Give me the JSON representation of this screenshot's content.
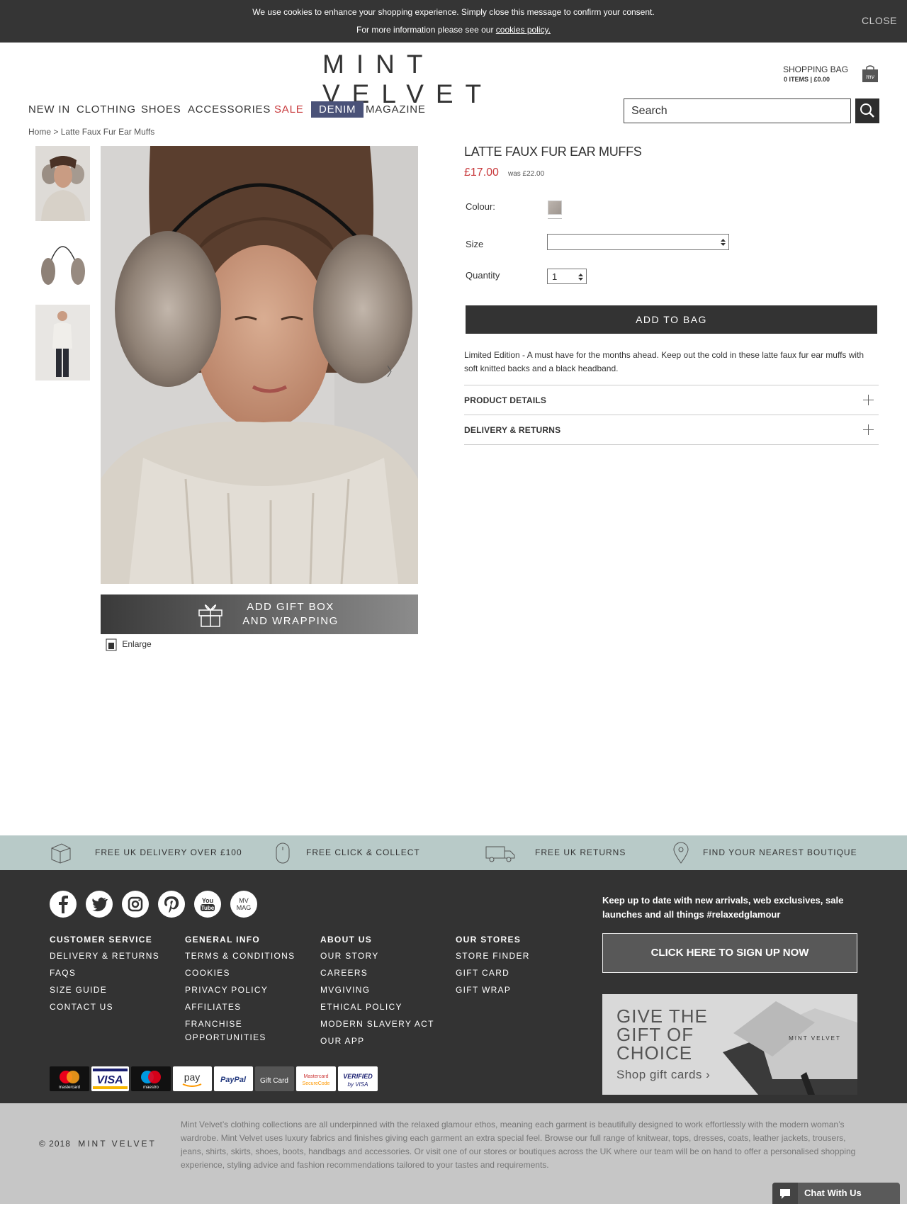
{
  "cookie": {
    "line1": "We use cookies to enhance your shopping experience. Simply close this message to confirm your consent.",
    "line2_prefix": "For more information please see our ",
    "policy_link": "cookies policy.",
    "close": "CLOSE"
  },
  "header": {
    "logo": "MINT VELVET",
    "bag_title": "SHOPPING BAG",
    "bag_summary": "0 ITEMS | £0.00",
    "bag_icon_text": "mv"
  },
  "nav": {
    "items": [
      "NEW IN",
      "CLOTHING",
      "SHOES",
      "ACCESSORIES",
      "SALE",
      "DENIM",
      "MAGAZINE"
    ],
    "search_placeholder": "Search"
  },
  "breadcrumb": {
    "home": "Home >",
    "current": "Latte Faux Fur Ear Muffs"
  },
  "gallery": {
    "gift_line1": "ADD GIFT BOX",
    "gift_line2": "AND WRAPPING",
    "enlarge": "Enlarge"
  },
  "product": {
    "title": "LATTE FAUX FUR EAR MUFFS",
    "price": "£17.00",
    "was": "was £22.00",
    "colour_label": "Colour:",
    "size_label": "Size",
    "size_value": "",
    "quantity_label": "Quantity",
    "quantity": "1",
    "add_to_bag": "ADD TO BAG",
    "description": "Limited Edition - A must have for the months ahead. Keep out the cold in these latte faux fur ear muffs with soft knitted backs and a black headband.",
    "accordions": [
      "PRODUCT DETAILS",
      "DELIVERY & RETURNS"
    ]
  },
  "usp": [
    "FREE UK DELIVERY OVER £100",
    "FREE CLICK & COLLECT",
    "FREE UK RETURNS",
    "FIND YOUR NEAREST BOUTIQUE"
  ],
  "footer": {
    "social_mag": "MV MAG",
    "columns": [
      {
        "heading": "CUSTOMER SERVICE",
        "links": [
          "DELIVERY & RETURNS",
          "FAQS",
          "SIZE GUIDE",
          "CONTACT US"
        ]
      },
      {
        "heading": "GENERAL INFO",
        "links": [
          "TERMS & CONDITIONS",
          "COOKIES",
          "PRIVACY POLICY",
          "AFFILIATES",
          "FRANCHISE OPPORTUNITIES"
        ]
      },
      {
        "heading": "ABOUT US",
        "links": [
          "OUR STORY",
          "CAREERS",
          "MVGIVING",
          "ETHICAL POLICY",
          "MODERN SLAVERY ACT",
          "OUR APP"
        ]
      },
      {
        "heading": "OUR STORES",
        "links": [
          "STORE FINDER",
          "GIFT CARD",
          "GIFT WRAP"
        ]
      }
    ],
    "newsletter": "Keep up to date with new arrivals, web exclusives, sale launches and all things #relaxedglamour",
    "signup": "CLICK HERE TO SIGN UP NOW",
    "gift_banner": {
      "line1": "GIVE THE",
      "line2": "GIFT OF",
      "line3": "CHOICE",
      "cta": "Shop gift cards ›",
      "card_brand": "MINT VELVET"
    },
    "payments": [
      "mastercard",
      "VISA",
      "maestro",
      "pay",
      "PayPal",
      "Gift Card",
      "Mastercard SecureCode",
      "VERIFIED by VISA"
    ]
  },
  "bottom": {
    "copyright": "© 2018",
    "brand": "MINT VELVET",
    "about": "Mint Velvet’s clothing collections are all underpinned with the relaxed glamour ethos, meaning each garment is beautifully designed to work effortlessly with the modern woman’s wardrobe. Mint Velvet uses luxury fabrics and finishes giving each garment an extra special feel. Browse our full range of knitwear, tops, dresses, coats, leather jackets, trousers, jeans, shirts, skirts, shoes, boots, handbags and accessories. Or visit one of our stores or boutiques across the UK where our team will be on hand to offer a personalised shopping experience, styling advice and fashion recommendations tailored to your tastes and requirements.",
    "chat": "Chat With Us"
  }
}
